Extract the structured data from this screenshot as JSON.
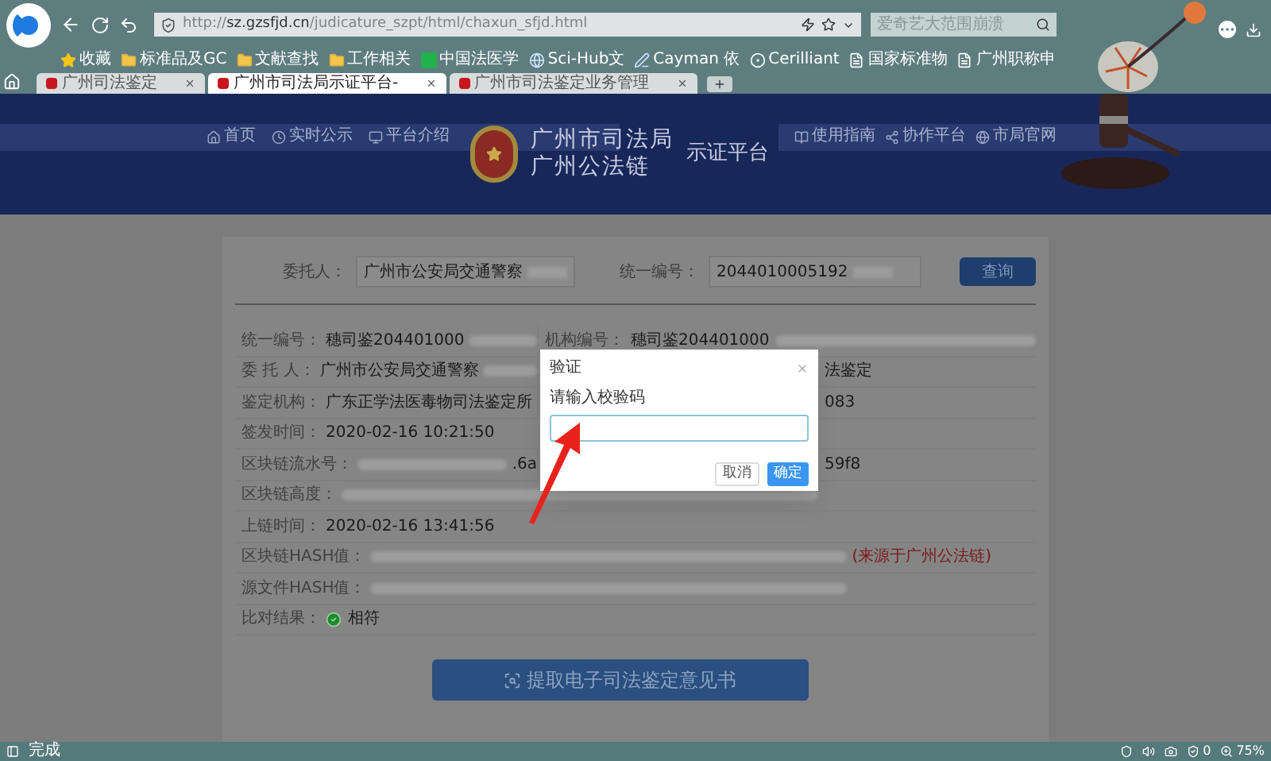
{
  "browser": {
    "url_scheme": "http://",
    "url_host": "sz.gzsfjd.cn",
    "url_path": "/judicature_szpt/html/chaxun_sfjd.html",
    "search_placeholder": "爱奇艺大范围崩溃",
    "bookmarks": [
      {
        "label": "收藏",
        "kind": "star"
      },
      {
        "label": "标准品及GC",
        "kind": "folder"
      },
      {
        "label": "文献查找",
        "kind": "folder"
      },
      {
        "label": "工作相关",
        "kind": "folder"
      },
      {
        "label": "中国法医学",
        "kind": "app"
      },
      {
        "label": "Sci-Hub文",
        "kind": "globe"
      },
      {
        "label": "Cayman 依",
        "kind": "pen"
      },
      {
        "label": "Cerilliant",
        "kind": "dot"
      },
      {
        "label": "国家标准物",
        "kind": "page"
      },
      {
        "label": "广州职称申",
        "kind": "page"
      }
    ],
    "tabs": [
      {
        "title": "广州司法鉴定",
        "selected": false
      },
      {
        "title": "广州市司法局示证平台-",
        "selected": true
      },
      {
        "title": "广州市司法鉴定业务管理",
        "selected": false
      }
    ]
  },
  "banner": {
    "nav_left": [
      {
        "label": "首页",
        "kind": "home"
      },
      {
        "label": "实时公示",
        "kind": "clock"
      },
      {
        "label": "平台介绍",
        "kind": "screen"
      }
    ],
    "title_lines": [
      "广州市司法局",
      "广州公法链"
    ],
    "title_side": "示证平台",
    "nav_right": [
      {
        "label": "使用指南",
        "kind": "guide"
      },
      {
        "label": "协作平台",
        "kind": "share"
      },
      {
        "label": "市局官网",
        "kind": "globe"
      }
    ]
  },
  "search": {
    "fields": [
      {
        "label": "委托人：",
        "value": "广州市公安局交通警察"
      },
      {
        "label": "统一编号：",
        "value": "2044010005192"
      }
    ],
    "button": "查询"
  },
  "record": [
    {
      "label": "统一编号：",
      "parts": [
        {
          "kind": "text",
          "text": "穗司鉴204401000"
        },
        {
          "kind": "blur"
        }
      ],
      "right": {
        "label": "机构编号：",
        "parts": [
          {
            "kind": "text",
            "text": "穗司鉴204401000"
          },
          {
            "kind": "blur"
          }
        ]
      }
    },
    {
      "label": "委 托 人：",
      "parts": [
        {
          "kind": "text",
          "text": "广州市公安局交通警察"
        },
        {
          "kind": "blur"
        }
      ],
      "right": {
        "parts": [
          {
            "kind": "text",
            "text": "法鉴定"
          }
        ]
      }
    },
    {
      "label": "鉴定机构：",
      "parts": [
        {
          "kind": "text",
          "text": "广东正学法医毒物司法鉴定所"
        }
      ],
      "right": {
        "parts": [
          {
            "kind": "text",
            "text": "083"
          }
        ]
      }
    },
    {
      "label": "签发时间：",
      "parts": [
        {
          "kind": "text",
          "text": "2020-02-16 10:21:50"
        }
      ]
    },
    {
      "label": "区块链流水号：",
      "parts": [
        {
          "kind": "blur"
        },
        {
          "kind": "text",
          "text": ".6a"
        }
      ],
      "right": {
        "parts": [
          {
            "kind": "text",
            "text": "59f8"
          }
        ]
      }
    },
    {
      "label": "区块链高度：",
      "parts": [
        {
          "kind": "blur"
        }
      ]
    },
    {
      "label": "上链时间：",
      "parts": [
        {
          "kind": "text",
          "text": "2020-02-16 13:41:56"
        }
      ]
    },
    {
      "label": "区块链HASH值：",
      "parts": [
        {
          "kind": "blur"
        },
        {
          "kind": "note",
          "text": "(来源于广州公法链)"
        }
      ]
    },
    {
      "label": "源文件HASH值：",
      "parts": [
        {
          "kind": "blur"
        }
      ]
    },
    {
      "label": "比对结果：",
      "parts": [
        {
          "kind": "ok",
          "text": "相符"
        }
      ]
    }
  ],
  "action_button": "提取电子司法鉴定意见书",
  "dialog": {
    "title": "验证",
    "prompt": "请输入校验码",
    "buttons": [
      {
        "label": "取消",
        "kind": "secondary"
      },
      {
        "label": "确定",
        "kind": "primary"
      }
    ]
  },
  "status_bar": {
    "status": "完成",
    "count": "0",
    "zoom": "75%"
  }
}
